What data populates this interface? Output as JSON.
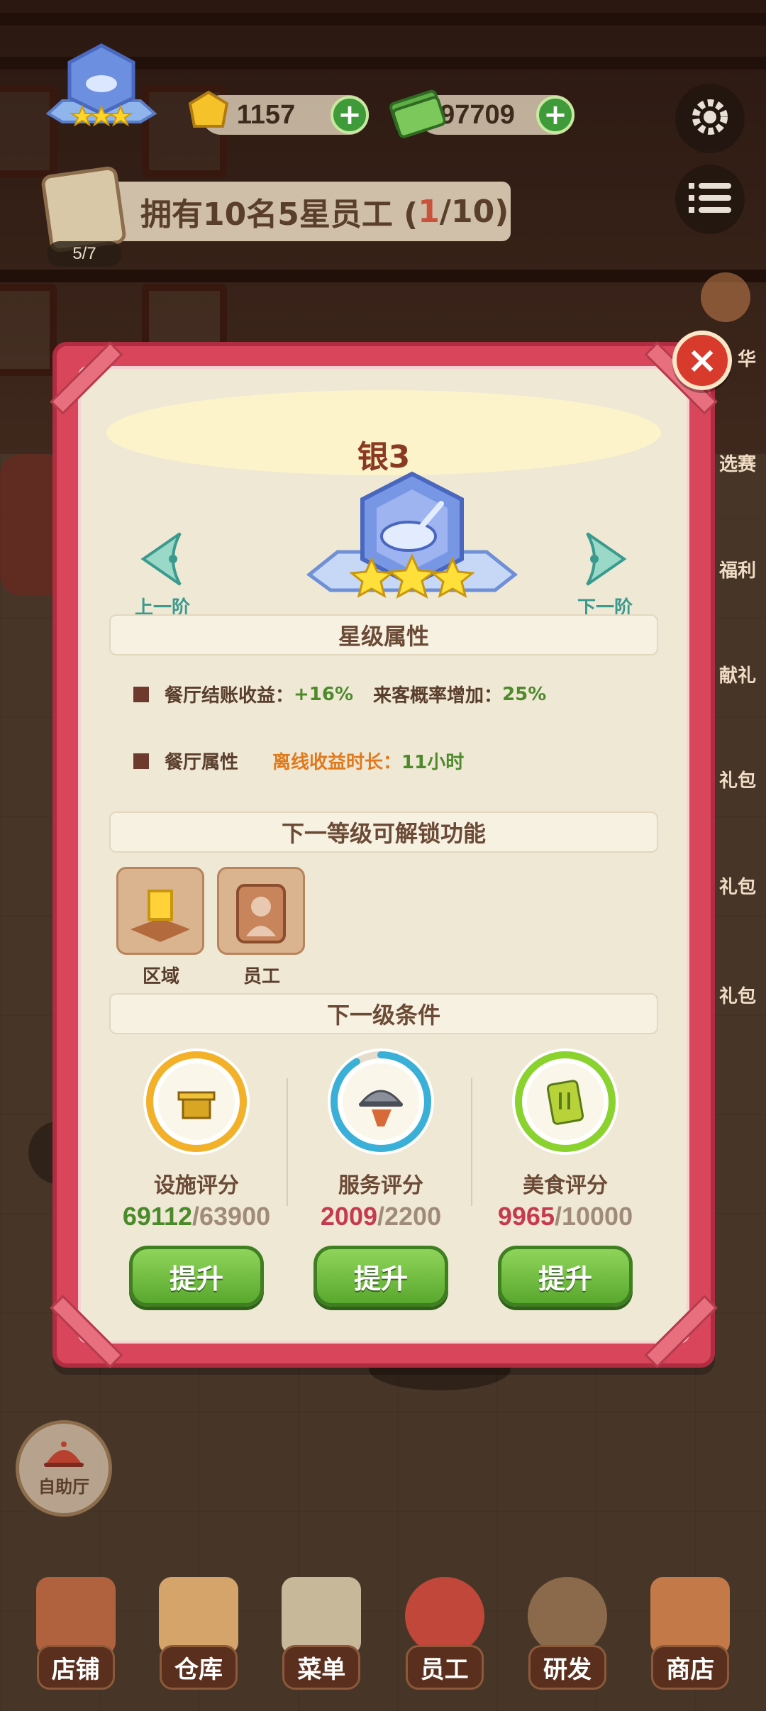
{
  "hud": {
    "gold_value": "1157",
    "cash_value": "97709",
    "plus": "+",
    "task_text": "拥有10名5星员工 (",
    "task_progress_current": "1",
    "task_progress_rest": "/10)",
    "task_count": "5/7",
    "side_labels": [
      "华",
      "选赛",
      "福利",
      "献礼",
      "礼包",
      "礼包",
      "礼包"
    ]
  },
  "modal": {
    "close": "×",
    "rank_title": "银3",
    "prev_label": "上一阶",
    "next_label": "下一阶",
    "star_section": "星级属性",
    "attr1_name": "餐厅结账收益：",
    "attr1_value": "+16%",
    "attr1_name2": "来客概率增加：",
    "attr1_value2": "25%",
    "attr2_name": "餐厅属性",
    "attr2_label": "离线收益时长：",
    "attr2_value": "11小时",
    "unlock_section": "下一等级可解锁功能",
    "unlocks": [
      {
        "label": "区域",
        "icon": "zone-icon"
      },
      {
        "label": "员工",
        "icon": "staff-icon"
      }
    ],
    "cond_section": "下一级条件",
    "conditions": [
      {
        "name": "设施评分",
        "current": "69112",
        "target": "/63900",
        "icon": "facility-icon",
        "ring": "#f3b12a",
        "progress": 1.0
      },
      {
        "name": "服务评分",
        "current": "2009",
        "target": "/2200",
        "icon": "service-icon",
        "ring": "#3ab0d8",
        "progress": 0.913
      },
      {
        "name": "美食评分",
        "current": "9965",
        "target": "/10000",
        "icon": "food-icon",
        "ring": "#8ad22e",
        "progress": 0.9965
      }
    ],
    "upgrade_label": "提升"
  },
  "buffet_label": "自助厅",
  "nav": [
    "店铺",
    "仓库",
    "菜单",
    "员工",
    "研发",
    "商店"
  ],
  "colors": {
    "modal_red": "#d9455a",
    "button_green": "#5aa82e",
    "accent_teal": "#3a9a8e"
  }
}
